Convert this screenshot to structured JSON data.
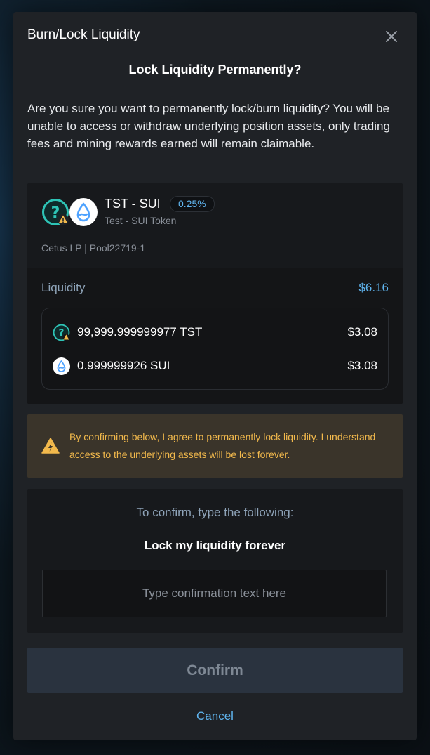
{
  "dialog": {
    "title": "Burn/Lock Liquidity",
    "subtitle": "Lock Liquidity Permanently?",
    "description": "Are you sure you want to permanently lock/burn liquidity? You will be unable to access or withdraw underlying position assets, only trading fees and mining rewards earned will remain claimable."
  },
  "position": {
    "pair": "TST - SUI",
    "fee_tier": "0.25%",
    "pair_full_name": "Test - SUI Token",
    "pool_info": "Cetus LP | Pool22719-1",
    "coin_a_icon": "unknown-token-icon",
    "coin_b_icon": "sui-icon"
  },
  "liquidity": {
    "label": "Liquidity",
    "total_usd": "$6.16",
    "assets": [
      {
        "amount": "99,999.999999977 TST",
        "usd": "$3.08",
        "icon": "unknown-token-icon"
      },
      {
        "amount": "0.999999926 SUI",
        "usd": "$3.08",
        "icon": "sui-icon"
      }
    ]
  },
  "warning": {
    "icon": "warning-icon",
    "text": "By confirming below, I agree to permanently lock liquidity. I understand access to the underlying assets will be lost forever."
  },
  "confirmation": {
    "instruction": "To confirm, type the following:",
    "phrase": "Lock my liquidity forever",
    "input_value": "",
    "input_placeholder": "Type confirmation text here"
  },
  "actions": {
    "confirm_label": "Confirm",
    "cancel_label": "Cancel"
  },
  "colors": {
    "accent": "#5fb4ee",
    "warning": "#f2b94c",
    "unknown_token": "#2ec4b6"
  }
}
